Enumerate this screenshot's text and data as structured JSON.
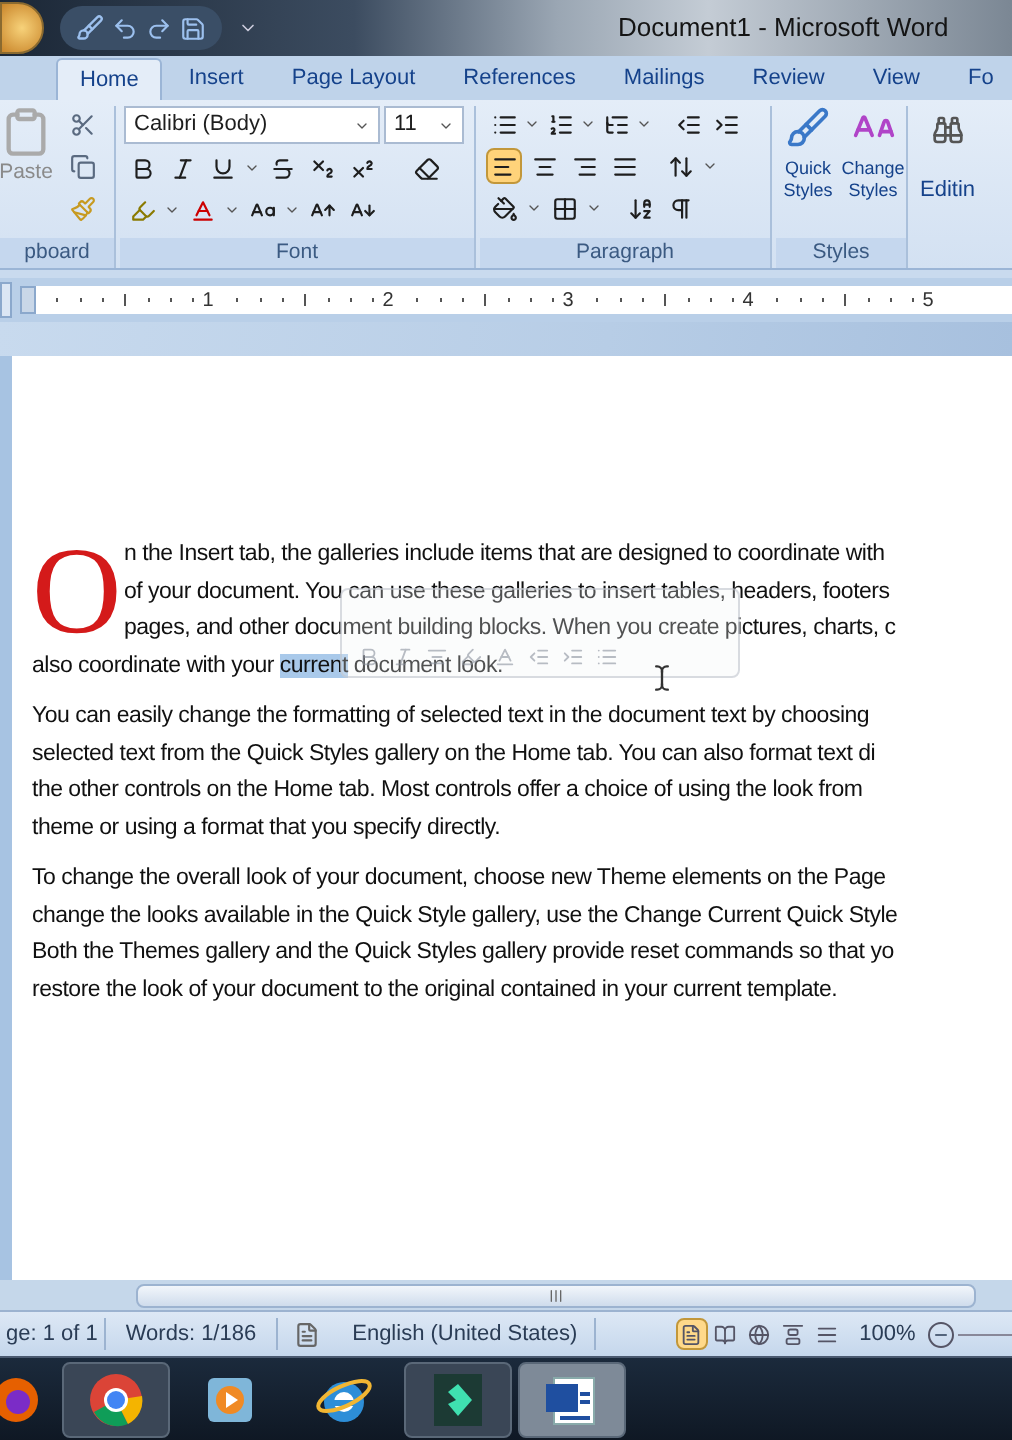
{
  "window": {
    "title": "Document1 - Microsoft Word"
  },
  "tabs": [
    {
      "label": "Home",
      "selected": true
    },
    {
      "label": "Insert",
      "selected": false
    },
    {
      "label": "Page Layout",
      "selected": false
    },
    {
      "label": "References",
      "selected": false
    },
    {
      "label": "Mailings",
      "selected": false
    },
    {
      "label": "Review",
      "selected": false
    },
    {
      "label": "View",
      "selected": false
    },
    {
      "label": "Fo",
      "selected": false
    }
  ],
  "ribbon": {
    "clipboard": {
      "paste_label": "Paste",
      "group_label": "pboard"
    },
    "font": {
      "font_name": "Calibri (Body)",
      "font_size": "11",
      "group_label": "Font"
    },
    "paragraph": {
      "group_label": "Paragraph",
      "alignments": [
        {
          "selected": true
        },
        {
          "selected": false
        },
        {
          "selected": false
        },
        {
          "selected": false
        }
      ]
    },
    "styles": {
      "buttons": [
        {
          "kind": "quick",
          "line1": "Quick",
          "line2": "Styles"
        },
        {
          "kind": "change",
          "line1": "Change",
          "line2": "Styles"
        }
      ],
      "group_label": "Styles"
    },
    "editing": {
      "label": "Editin"
    }
  },
  "ruler": {
    "numbers": [
      "1",
      "2",
      "3",
      "4",
      "5"
    ]
  },
  "document": {
    "drop_cap": "O",
    "drop_cap_lines": [
      {
        "parts": [
          {
            "text": "n the Insert tab, the galleries include items that are designed to coordinate with",
            "selected": false
          }
        ]
      },
      {
        "parts": [
          {
            "text": "of your document. You can use these galleries to insert tables, headers, footers",
            "selected": false
          }
        ]
      },
      {
        "parts": [
          {
            "text": "pages, and other document building blocks. When you create pictures, charts, c",
            "selected": false
          }
        ]
      }
    ],
    "paragraphs": [
      {
        "lines": [
          {
            "parts": [
              {
                "text": "also coordinate with your ",
                "selected": false
              },
              {
                "text": "current",
                "selected": true
              },
              {
                "text": " document look.",
                "selected": false
              }
            ]
          }
        ]
      },
      {
        "lines": [
          {
            "parts": [
              {
                "text": "You can easily change the formatting of selected text in the document text by choosing",
                "selected": false
              }
            ]
          },
          {
            "parts": [
              {
                "text": "selected text from the Quick Styles gallery on the Home tab. You can also format text di",
                "selected": false
              }
            ]
          },
          {
            "parts": [
              {
                "text": "the other controls on the Home tab. Most controls offer a choice of using the look from",
                "selected": false
              }
            ]
          },
          {
            "parts": [
              {
                "text": "theme or using a format that you specify directly.",
                "selected": false
              }
            ]
          }
        ]
      },
      {
        "lines": [
          {
            "parts": [
              {
                "text": "To change the overall look of your document, choose new Theme elements on the Page",
                "selected": false
              }
            ]
          },
          {
            "parts": [
              {
                "text": "change the looks available in the Quick Style gallery, use the Change Current Quick Style",
                "selected": false
              }
            ]
          },
          {
            "parts": [
              {
                "text": "Both the Themes gallery and the Quick Styles gallery provide reset commands so that yo",
                "selected": false
              }
            ]
          },
          {
            "parts": [
              {
                "text": "restore the look of your document to the original contained in your current template.",
                "selected": false
              }
            ]
          }
        ]
      }
    ],
    "mini_toolbar": {
      "visible": true
    }
  },
  "status_bar": {
    "items": [
      "ge: 1 of 1",
      "Words: 1/186",
      "English (United States)"
    ],
    "views": [
      {
        "selected": true
      },
      {
        "selected": false
      },
      {
        "selected": false
      },
      {
        "selected": false
      },
      {
        "selected": false
      }
    ],
    "zoom": "100%"
  },
  "taskbar": {
    "items": [
      {
        "kind": "fox",
        "open": false,
        "active": false
      },
      {
        "kind": "chrome",
        "open": true,
        "active": false
      },
      {
        "kind": "media",
        "open": false,
        "active": false
      },
      {
        "kind": "ie",
        "open": false,
        "active": false
      },
      {
        "kind": "editor",
        "open": true,
        "active": false
      },
      {
        "kind": "word",
        "open": true,
        "active": true
      }
    ]
  }
}
